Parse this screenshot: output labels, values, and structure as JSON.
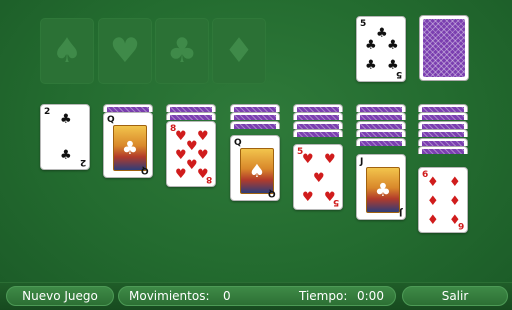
{
  "game": "Solitaire",
  "foundations": [
    {
      "suit": "♠"
    },
    {
      "suit": "♥"
    },
    {
      "suit": "♣"
    },
    {
      "suit": "♦"
    }
  ],
  "waste": {
    "rank": "5",
    "suit": "♣"
  },
  "tableau": [
    {
      "face_down": 0,
      "top": {
        "rank": "2",
        "suit": "♣"
      }
    },
    {
      "face_down": 1,
      "top": {
        "rank": "Q",
        "suit": "♣"
      }
    },
    {
      "face_down": 2,
      "top": {
        "rank": "8",
        "suit": "♥"
      }
    },
    {
      "face_down": 3,
      "top": {
        "rank": "Q",
        "suit": "♠"
      }
    },
    {
      "face_down": 4,
      "top": {
        "rank": "5",
        "suit": "♥"
      }
    },
    {
      "face_down": 5,
      "top": {
        "rank": "J",
        "suit": "♣"
      }
    },
    {
      "face_down": 6,
      "top": {
        "rank": "6",
        "suit": "♦"
      }
    }
  ],
  "bottom_bar": {
    "new_game": "Nuevo Juego",
    "moves_label": "Movimientos:",
    "moves_value": "0",
    "time_label": "Tiempo:",
    "time_value": "0:00",
    "exit": "Salir"
  },
  "colors": {
    "felt": "#236b2f",
    "card_back": "#7b3fb0",
    "red_suit": "#d01c1c",
    "black_suit": "#111111"
  }
}
